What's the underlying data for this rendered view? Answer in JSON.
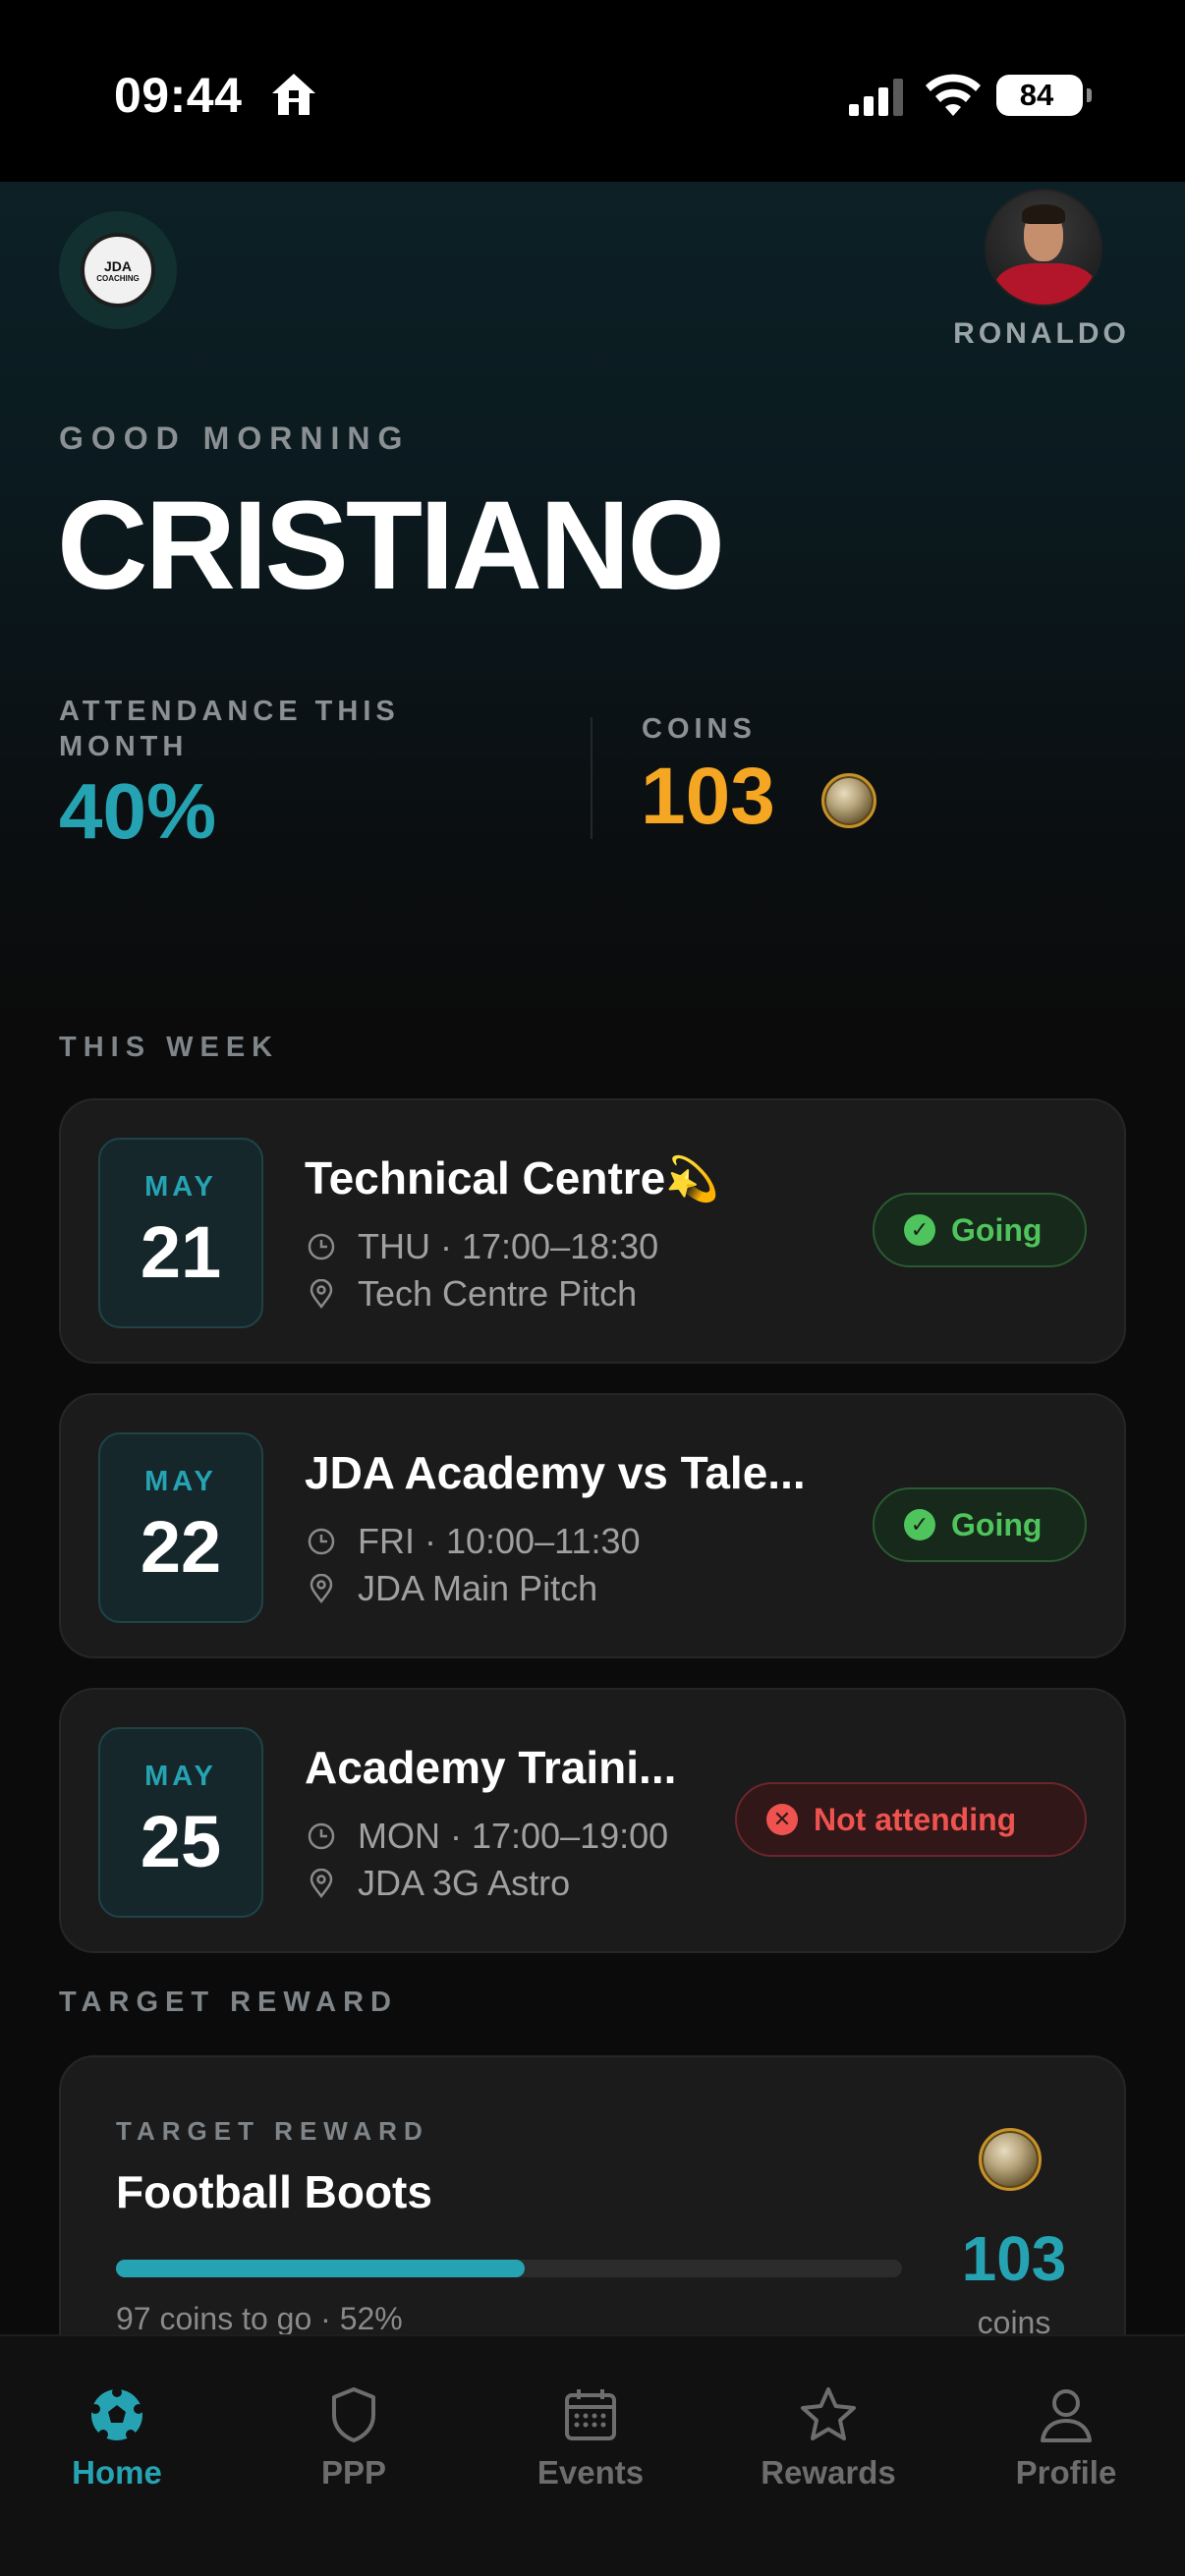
{
  "status_bar": {
    "time": "09:44",
    "battery": "84"
  },
  "header": {
    "avatar_name": "RONALDO",
    "greeting": "GOOD MORNING",
    "name": "CRISTIANO",
    "logo_text_top": "JDA",
    "logo_text_bottom": "COACHING"
  },
  "stats": {
    "attendance_label": "ATTENDANCE THIS MONTH",
    "attendance_value": "40%",
    "coins_label": "COINS",
    "coins_value": "103"
  },
  "this_week": {
    "title": "THIS WEEK",
    "events": [
      {
        "month": "MAY",
        "day": "21",
        "title": "Technical Centre",
        "emoji": "💫",
        "time": "THU · 17:00–18:30",
        "location": "Tech Centre Pitch",
        "status": "Going"
      },
      {
        "month": "MAY",
        "day": "22",
        "title": "JDA Academy vs Tale...",
        "emoji": "",
        "time": "FRI · 10:00–11:30",
        "location": "JDA Main Pitch",
        "status": "Going"
      },
      {
        "month": "MAY",
        "day": "25",
        "title": "Academy Traini...",
        "emoji": "",
        "time": "MON · 17:00–19:00",
        "location": "JDA 3G Astro",
        "status": "Not attending"
      }
    ]
  },
  "target_reward": {
    "section_title": "TARGET REWARD",
    "label": "TARGET REWARD",
    "title": "Football Boots",
    "progress": 0.52,
    "subtitle": "97 coins to go  ·  52%",
    "coins_value": "103",
    "coins_label": "coins"
  },
  "tabs": [
    {
      "label": "Home",
      "icon": "soccer-ball-icon",
      "active": true
    },
    {
      "label": "PPP",
      "icon": "shield-icon",
      "active": false
    },
    {
      "label": "Events",
      "icon": "calendar-icon",
      "active": false
    },
    {
      "label": "Rewards",
      "icon": "star-icon",
      "active": false
    },
    {
      "label": "Profile",
      "icon": "person-icon",
      "active": false
    }
  ],
  "colors": {
    "accent": "#26a3b2",
    "coin": "#f5a623",
    "going": "#4fc45c",
    "not_attending": "#ef5350"
  }
}
